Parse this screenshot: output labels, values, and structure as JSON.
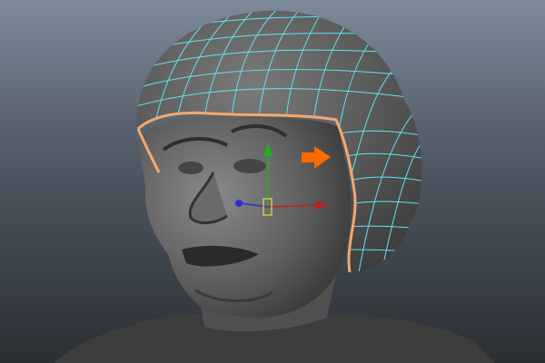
{
  "viewport": {
    "background_top": "#7d8a99",
    "background_bottom": "#2b2f34",
    "wireframe_color": "#5fe3f5",
    "selection_outline_color": "#f5a86a",
    "pointer_arrow_color": "#ff6a00"
  },
  "gizmo": {
    "x_axis_color": "#c02020",
    "y_axis_color": "#20b020",
    "z_axis_color": "#3030d0",
    "pivot_color": "#e0d040"
  },
  "icons": [
    "move-manipulator-icon",
    "pointer-arrow-icon"
  ]
}
